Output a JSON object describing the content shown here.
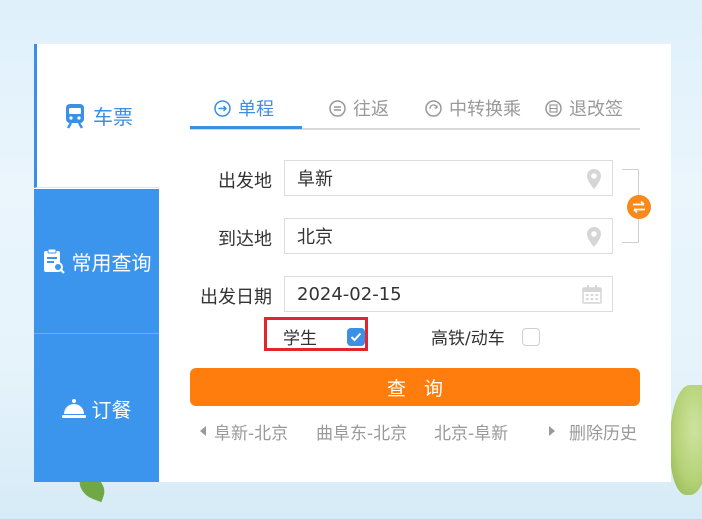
{
  "nav": {
    "ticket": {
      "label": "车票",
      "icon": "train-icon"
    },
    "common_query": {
      "label": "常用查询",
      "icon": "clipboard-search-icon"
    },
    "meal": {
      "label": "订餐",
      "icon": "cloche-icon"
    }
  },
  "tabs": [
    {
      "label": "单程",
      "icon": "single-trip-icon",
      "active": true
    },
    {
      "label": "往返",
      "icon": "round-trip-icon",
      "active": false
    },
    {
      "label": "中转换乘",
      "icon": "transfer-icon",
      "active": false
    },
    {
      "label": "退改签",
      "icon": "refund-ticket-icon",
      "active": false
    }
  ],
  "form": {
    "departure": {
      "label": "出发地",
      "value": "阜新",
      "icon": "location-pin-icon"
    },
    "arrival": {
      "label": "到达地",
      "value": "北京",
      "icon": "location-pin-icon"
    },
    "date": {
      "label": "出发日期",
      "value": "2024-02-15",
      "icon": "calendar-icon"
    },
    "student": {
      "label": "学生",
      "checked": true
    },
    "highspeed": {
      "label": "高铁/动车",
      "checked": false
    },
    "search_label": "查询"
  },
  "history": {
    "items": [
      "阜新-北京",
      "曲阜东-北京",
      "北京-阜新"
    ],
    "delete_label": "删除历史"
  },
  "colors": {
    "accent": "#3b8fe4",
    "nav_bg": "#3b95ec",
    "search": "#ff7d0d",
    "highlight": "#e2262c"
  }
}
